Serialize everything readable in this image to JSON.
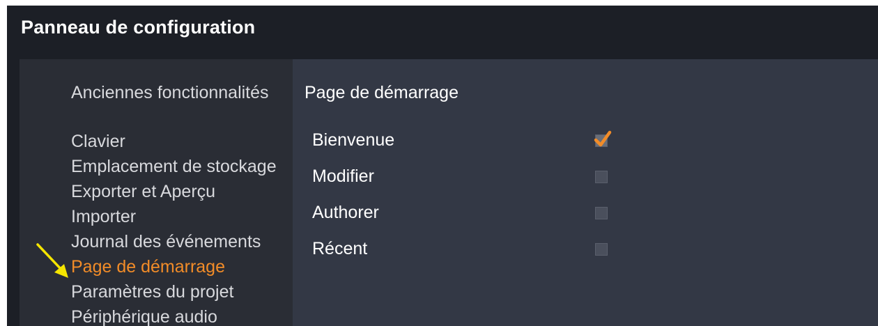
{
  "window": {
    "title": "Panneau de configuration"
  },
  "sidebar": {
    "group_label": "Anciennes fonctionnalités",
    "items": [
      {
        "label": "Clavier",
        "active": false
      },
      {
        "label": "Emplacement de stockage",
        "active": false
      },
      {
        "label": "Exporter et Aperçu",
        "active": false
      },
      {
        "label": "Importer",
        "active": false
      },
      {
        "label": "Journal des événements",
        "active": false
      },
      {
        "label": "Page de démarrage",
        "active": true
      },
      {
        "label": "Paramètres du projet",
        "active": false
      },
      {
        "label": "Périphérique audio",
        "active": false
      }
    ]
  },
  "content": {
    "title": "Page de démarrage",
    "options": [
      {
        "label": "Bienvenue",
        "checked": true
      },
      {
        "label": "Modifier",
        "checked": false
      },
      {
        "label": "Authorer",
        "checked": false
      },
      {
        "label": "Récent",
        "checked": false
      }
    ]
  },
  "colors": {
    "accent": "#f28c28",
    "annotation_arrow": "#f5e500",
    "title_bar": "#1c1f26",
    "sidebar_bg": "#2a2d35",
    "content_bg": "#333845"
  },
  "icons": {
    "annotation": "arrow-pointer-icon",
    "check": "checkmark-icon"
  }
}
